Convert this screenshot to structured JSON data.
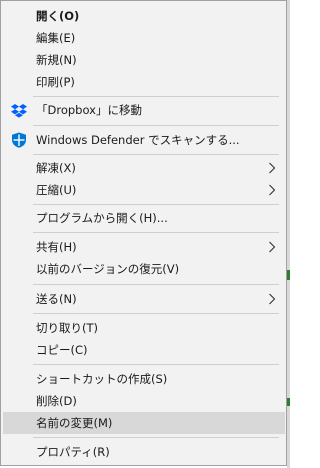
{
  "menu": {
    "items": [
      {
        "label": "開く(O)"
      },
      {
        "label": "編集(E)"
      },
      {
        "label": "新規(N)"
      },
      {
        "label": "印刷(P)"
      },
      {
        "label": "「Dropbox」に移動",
        "icon": "dropbox-icon"
      },
      {
        "label": "Windows Defender でスキャンする...",
        "icon": "windows-defender-icon"
      },
      {
        "label": "解凍(X)"
      },
      {
        "label": "圧縮(U)"
      },
      {
        "label": "プログラムから開く(H)..."
      },
      {
        "label": "共有(H)"
      },
      {
        "label": "以前のバージョンの復元(V)"
      },
      {
        "label": "送る(N)"
      },
      {
        "label": "切り取り(T)"
      },
      {
        "label": "コピー(C)"
      },
      {
        "label": "ショートカットの作成(S)"
      },
      {
        "label": "削除(D)"
      },
      {
        "label": "名前の変更(M)"
      },
      {
        "label": "プロパティ(R)"
      }
    ]
  },
  "colors": {
    "menu_bg": "#f2f2f2",
    "hover_bg": "#d8d8d8",
    "dropbox_blue": "#0061fe",
    "defender_blue": "#0078d7"
  }
}
